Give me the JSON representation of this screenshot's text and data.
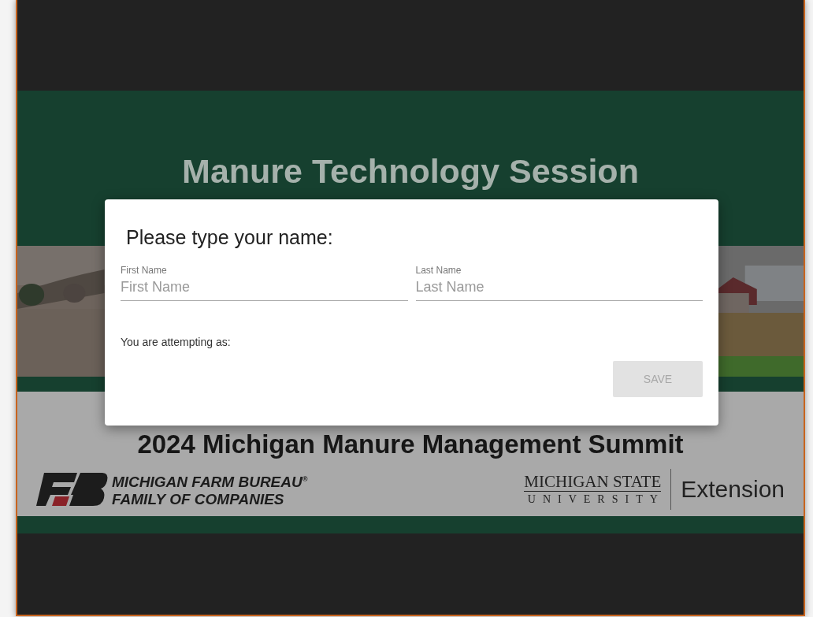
{
  "slide": {
    "title": "Manure Technology Session",
    "subtitle": "2024 Michigan Manure Management Summit",
    "logos": [
      {
        "kind": "farm-bureau",
        "lines": [
          "MICHIGAN FARM BUREAU$^{®}$",
          "FAMILY OF COMPANIES"
        ]
      },
      {
        "kind": "university",
        "lines": [
          "MICHIGAN STATE",
          "UNIVERSITY",
          "Extension"
        ]
      }
    ]
  },
  "dialog": {
    "title": "Please type your name:",
    "fields": [
      {
        "label": "First Name",
        "placeholder": "First Name"
      },
      {
        "label": "Last Name",
        "placeholder": "Last Name"
      }
    ],
    "note": "You are attempting as:",
    "button": {
      "label": "SAVE",
      "disabled": true
    }
  }
}
